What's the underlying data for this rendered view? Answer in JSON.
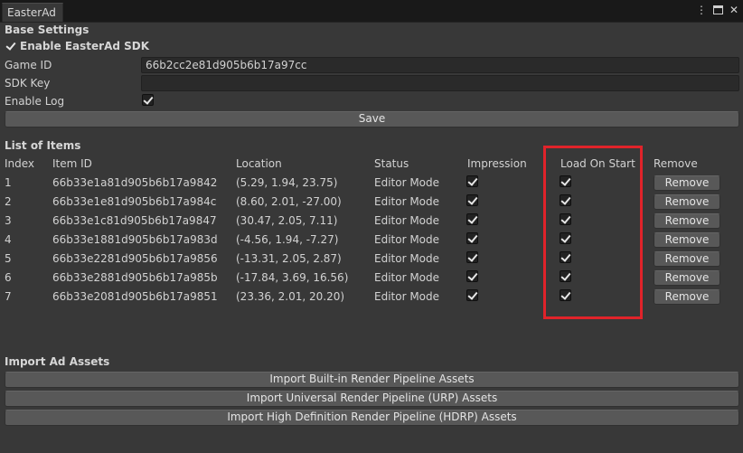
{
  "window": {
    "tab_title": "EasterAd",
    "controls": {
      "menu": "⋮",
      "close": "✕"
    }
  },
  "base_settings": {
    "heading": "Base Settings",
    "enable_sdk_label": "Enable EasterAd SDK",
    "enable_sdk_checked": true,
    "game_id_label": "Game ID",
    "game_id_value": "66b2cc2e81d905b6b17a97cc",
    "sdk_key_label": "SDK Key",
    "sdk_key_value": "",
    "enable_log_label": "Enable Log",
    "enable_log_checked": true,
    "save_label": "Save"
  },
  "items": {
    "heading": "List of Items",
    "columns": [
      "Index",
      "Item ID",
      "Location",
      "Status",
      "Impression",
      "Load On Start",
      "Remove"
    ],
    "remove_label": "Remove",
    "rows": [
      {
        "index": "1",
        "item_id": "66b33e1a81d905b6b17a9842",
        "location": "(5.29, 1.94, 23.75)",
        "status": "Editor Mode",
        "impression": true,
        "load_on_start": true
      },
      {
        "index": "2",
        "item_id": "66b33e1e81d905b6b17a984c",
        "location": "(8.60, 2.01, -27.00)",
        "status": "Editor Mode",
        "impression": true,
        "load_on_start": true
      },
      {
        "index": "3",
        "item_id": "66b33e1c81d905b6b17a9847",
        "location": "(30.47, 2.05, 7.11)",
        "status": "Editor Mode",
        "impression": true,
        "load_on_start": true
      },
      {
        "index": "4",
        "item_id": "66b33e1881d905b6b17a983d",
        "location": "(-4.56, 1.94, -7.27)",
        "status": "Editor Mode",
        "impression": true,
        "load_on_start": true
      },
      {
        "index": "5",
        "item_id": "66b33e2281d905b6b17a9856",
        "location": "(-13.31, 2.05, 2.87)",
        "status": "Editor Mode",
        "impression": true,
        "load_on_start": true
      },
      {
        "index": "6",
        "item_id": "66b33e2881d905b6b17a985b",
        "location": "(-17.84, 3.69, 16.56)",
        "status": "Editor Mode",
        "impression": true,
        "load_on_start": true
      },
      {
        "index": "7",
        "item_id": "66b33e2081d905b6b17a9851",
        "location": "(23.36, 2.01, 20.20)",
        "status": "Editor Mode",
        "impression": true,
        "load_on_start": true
      }
    ]
  },
  "import": {
    "heading": "Import Ad Assets",
    "builtin_label": "Import Built-in Render Pipeline Assets",
    "urp_label": "Import Universal Render Pipeline (URP) Assets",
    "hdrp_label": "Import High Definition Render Pipeline (HDRP) Assets"
  },
  "colors": {
    "panel_bg": "#383838",
    "button_bg": "#585858",
    "highlight": "#e0232a"
  }
}
